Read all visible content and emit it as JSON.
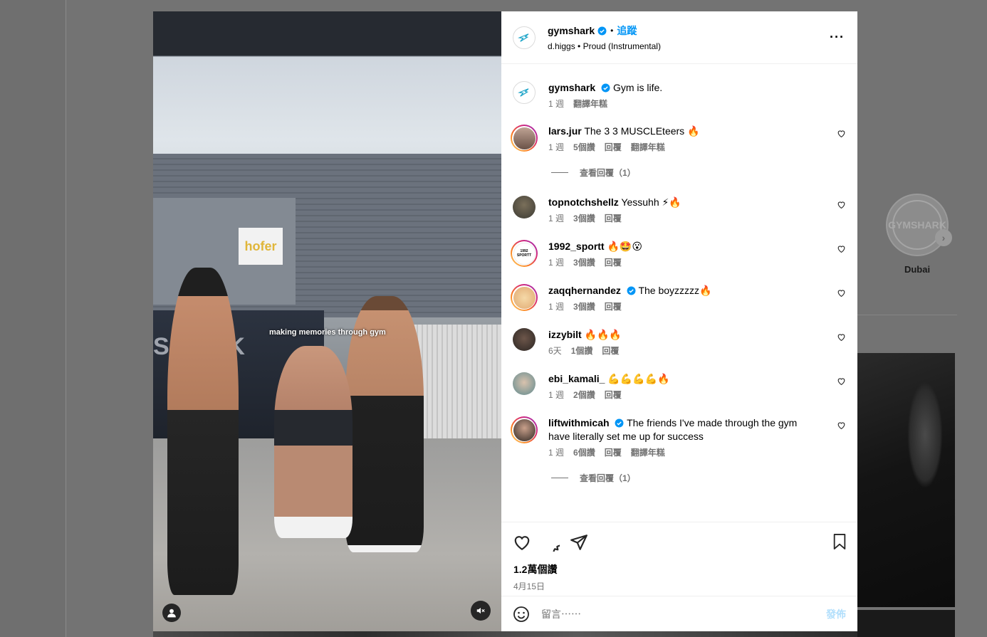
{
  "background": {
    "highlight_label": "Dubai",
    "highlight_text": "GYMSHARK",
    "next_arrow": "›"
  },
  "media": {
    "caption": "making memories through gym",
    "sign_text": "hofer",
    "wall_text": "SHARK"
  },
  "header": {
    "username": "gymshark",
    "follow_label": "追蹤",
    "separator": "•",
    "music_artist": "d.higgs",
    "music_title": "Proud (Instrumental)",
    "more_label": "···"
  },
  "caption": {
    "username": "gymshark",
    "text": "Gym is life.",
    "time": "1 週",
    "translate": "翻譯年糕"
  },
  "comments": [
    {
      "username": "lars.jur",
      "text": "The 3 3 MUSCLEteers 🔥",
      "time": "1 週",
      "likes": "5個讚",
      "reply": "回覆",
      "translate": "翻譯年糕",
      "view_replies": "查看回覆（1）"
    },
    {
      "username": "topnotchshellz",
      "text": "Yessuhh ⚡🔥",
      "time": "1 週",
      "likes": "3個讚",
      "reply": "回覆"
    },
    {
      "username": "1992_sportt",
      "text": "🔥🤩😮",
      "time": "1 週",
      "likes": "3個讚",
      "reply": "回覆",
      "avatar_text": "1992 SPORTT"
    },
    {
      "username": "zaqqhernandez",
      "text": "The boyzzzzz🔥",
      "time": "1 週",
      "likes": "3個讚",
      "reply": "回覆"
    },
    {
      "username": "izzybilt",
      "text": "🔥🔥🔥",
      "time": "6天",
      "likes": "1個讚",
      "reply": "回覆"
    },
    {
      "username": "ebi_kamali_",
      "text": "💪💪💪💪🔥",
      "time": "1 週",
      "likes": "2個讚",
      "reply": "回覆"
    },
    {
      "username": "liftwithmicah",
      "text": "The friends I've made through the gym have literally set me up for success",
      "time": "1 週",
      "likes": "6個讚",
      "reply": "回覆",
      "translate": "翻譯年糕",
      "view_replies": "查看回覆（1）"
    }
  ],
  "actions": {
    "likes": "1.2萬個讚",
    "date": "4月15日"
  },
  "compose": {
    "placeholder": "留言⋯⋯",
    "post_label": "發佈"
  },
  "colors": {
    "accent": "#0095f6",
    "post_disabled": "#b2dffc",
    "meta": "#737373"
  }
}
